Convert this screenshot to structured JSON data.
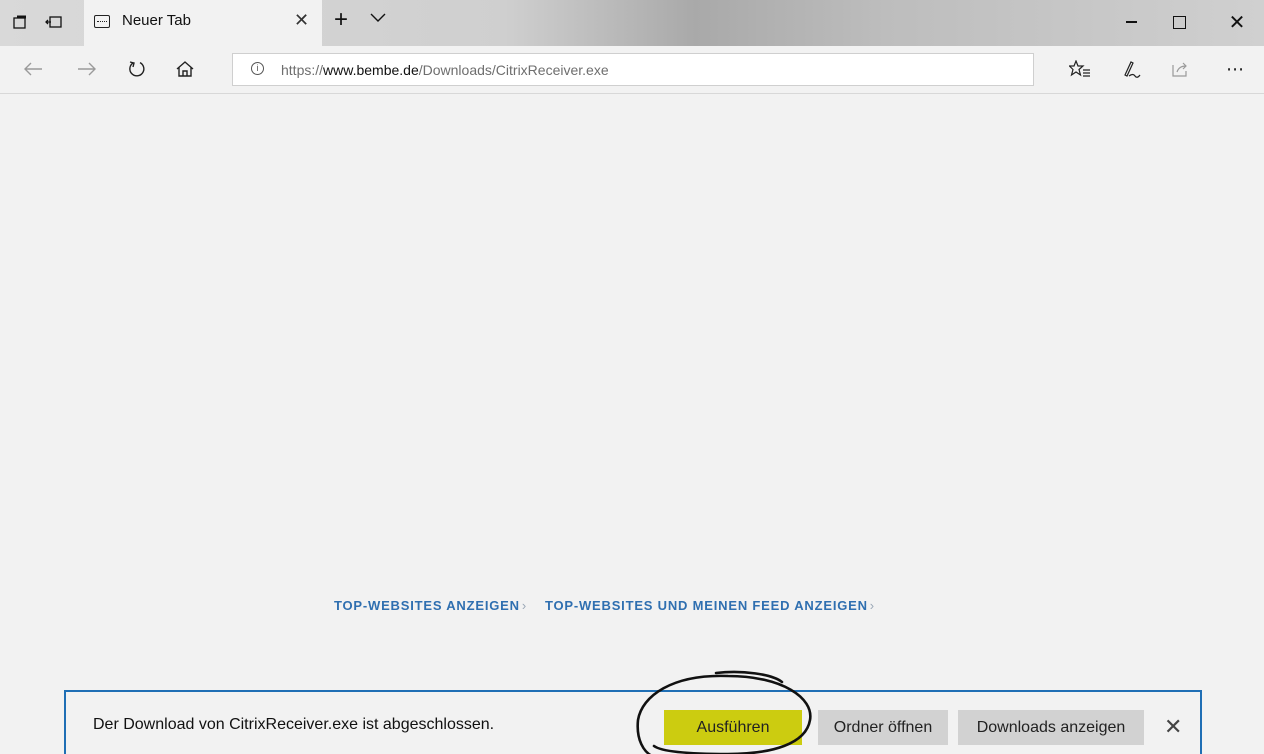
{
  "tab": {
    "title": "Neuer Tab"
  },
  "titlebar": {
    "new_tab_symbol": "+",
    "tab_menu_symbol": "∨"
  },
  "address": {
    "scheme": "https://",
    "host": "www.bembe.de",
    "path": "/Downloads/CitrixReceiver.exe"
  },
  "icons": {
    "tab_preview": "set-tabs-aside-icon",
    "tabs_aside": "restore-tabs-icon",
    "back": "back-arrow-icon",
    "forward": "forward-arrow-icon",
    "refresh": "refresh-icon",
    "home": "home-icon",
    "favorites": "favorites-icon",
    "notes": "pen-icon",
    "share": "share-icon",
    "more": "more-icon"
  },
  "content": {
    "link_top_sites": "TOP-WEBSITES ANZEIGEN",
    "link_top_sites_feed": "TOP-WEBSITES UND MEINEN FEED ANZEIGEN"
  },
  "download": {
    "message": "Der Download von CitrixReceiver.exe ist abgeschlossen.",
    "run_label": "Ausführen",
    "open_folder_label": "Ordner öffnen",
    "show_downloads_label": "Downloads anzeigen"
  },
  "colors": {
    "accent_blue": "#1f6fb5",
    "link_blue": "#2f6fb0",
    "highlight_yellow": "#cccc10"
  }
}
